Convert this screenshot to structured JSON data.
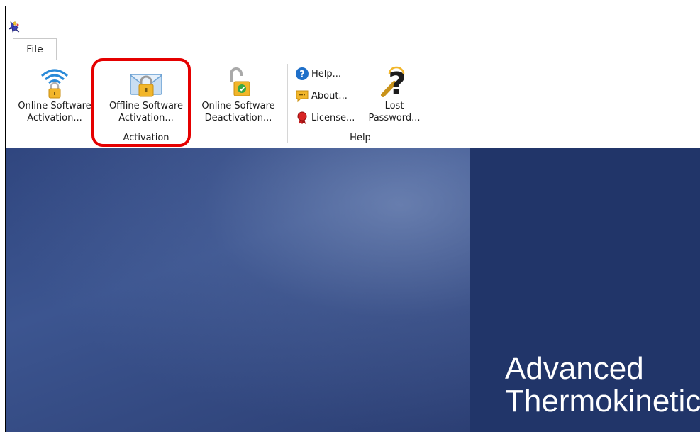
{
  "tabs": {
    "file_label": "File"
  },
  "ribbon": {
    "activation": {
      "online_activation": {
        "line1": "Online Software",
        "line2": "Activation..."
      },
      "offline_activation": {
        "line1": "Offline Software",
        "line2": "Activation..."
      },
      "online_deactivation": {
        "line1": "Online Software",
        "line2": "Deactivation..."
      },
      "group_label": "Activation"
    },
    "help": {
      "help_label": "Help...",
      "about_label": "About...",
      "license_label": "License...",
      "lost_password": {
        "line1": "Lost",
        "line2": "Password..."
      },
      "group_label": "Help"
    }
  },
  "banner": {
    "title_line1": "Advanced",
    "title_line2": "Thermokinetics"
  },
  "colors": {
    "highlight": "#e50000",
    "banner_dark": "#213569",
    "banner_mid": "#3e5791",
    "lock_gold": "#f2b62a"
  },
  "icons": {
    "app": "app-logo-icon",
    "online_activation": "wifi-lock-icon",
    "offline_activation": "envelope-lock-icon",
    "online_deactivation": "open-padlock-icon",
    "help": "question-circle-icon",
    "about": "speech-bubble-icon",
    "license": "ribbon-seal-icon",
    "lost_password": "gold-question-mark-icon"
  }
}
